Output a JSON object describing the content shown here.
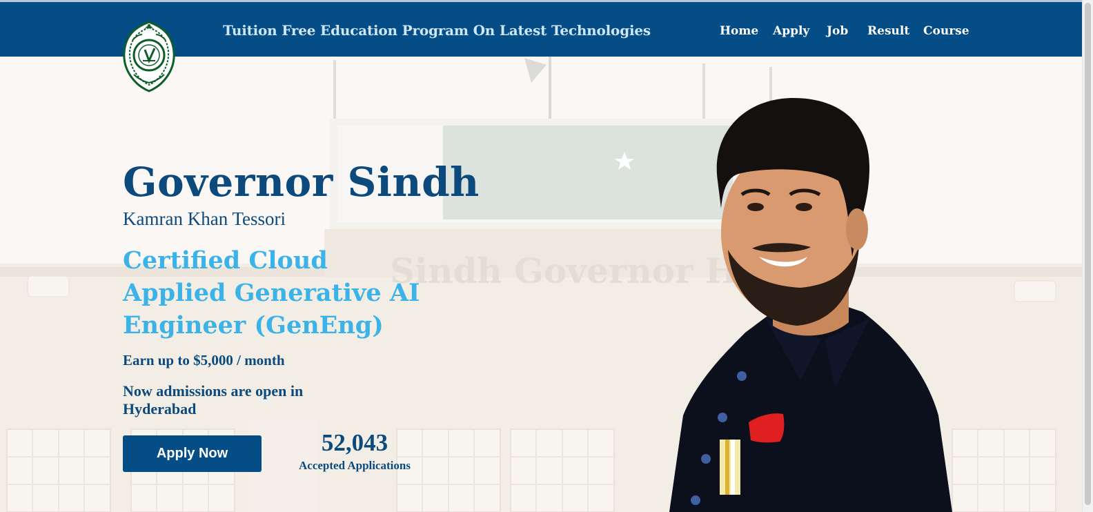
{
  "header": {
    "site_title": "Tuition Free Education Program On Latest Technologies",
    "logo_icon": "governor-sindh-emblem",
    "nav": [
      {
        "label": "Home"
      },
      {
        "label": "Apply"
      },
      {
        "label": "Job"
      },
      {
        "label": "Result"
      },
      {
        "label": "Course"
      }
    ]
  },
  "hero": {
    "headline": "Governor Sindh",
    "subname": "Kamran Khan Tessori",
    "program_lines": [
      "Certified Cloud",
      "Applied Generative AI",
      "Engineer (GenEng)"
    ],
    "earn": "Earn up to $5,000 / month",
    "admission": "Now admissions are open in Hyderabad",
    "apply_button": "Apply Now",
    "stat": {
      "value": "52,043",
      "label": "Accepted Applications"
    },
    "background_sign": "Sindh Governor House"
  },
  "colors": {
    "header_bg": "#054d86",
    "title_color": "#cfe6f7",
    "headline_color": "#0c4a7d",
    "program_color": "#3bb2e8",
    "button_bg": "#054d86"
  }
}
